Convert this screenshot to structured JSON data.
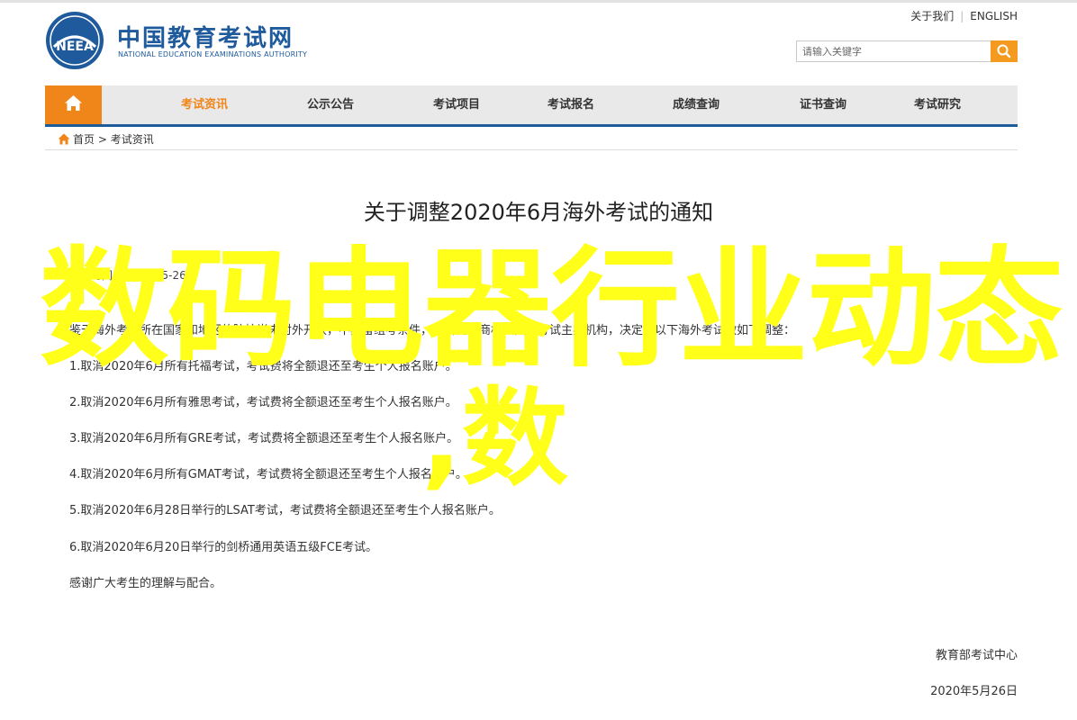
{
  "header": {
    "brand_cn": "中国教育考试网",
    "brand_en": "NATIONAL EDUCATION EXAMINATIONS AUTHORITY",
    "logo_text": "NEEA",
    "util_links": {
      "homepage": "关于我们",
      "english": "ENGLISH"
    },
    "search": {
      "placeholder": "请输入关键字"
    }
  },
  "nav": {
    "items": [
      {
        "label": "考试资讯",
        "active": true
      },
      {
        "label": "公示公告"
      },
      {
        "label": "考试项目"
      },
      {
        "label": "考试报名"
      },
      {
        "label": "成绩查询"
      },
      {
        "label": "证书查询"
      },
      {
        "label": "考试研究"
      }
    ]
  },
  "breadcrumb": {
    "home": "首页",
    "separator": ">",
    "current": "考试资讯"
  },
  "article": {
    "title": "关于调整2020年6月海外考试的通知",
    "meta": "发布时间：2020-05-26",
    "intro": "鉴于海外考点所在国家和地区的院校尚未对外开放，不具备组考条件，经研究并商相关国外考试主办机构，决定对以下海外考试做如下调整：",
    "paragraphs": [
      "1.取消2020年6月所有托福考试，考试费将全额退还至考生个人报名账户。",
      "2.取消2020年6月所有雅思考试，考试费将全额退还至考生个人报名账户。",
      "3.取消2020年6月所有GRE考试，考试费将全额退还至考生个人报名账户。",
      "4.取消2020年6月所有GMAT考试，考试费将全额退还至考生个人报名账户。",
      "5.取消2020年6月28日举行的LSAT考试，考试费将全额退还至考生个人报名账户。",
      "6.取消2020年6月20日举行的剑桥通用英语五级FCE考试。",
      "感谢广大考生的理解与配合。"
    ],
    "signature": "教育部考试中心",
    "date": "2020年5月26日"
  },
  "watermark": {
    "line1": "数码电器行业动态",
    "line2": ",数"
  },
  "colors": {
    "brand_blue": "#1e5a9c",
    "accent_orange": "#f08519",
    "watermark_yellow": "#ffff1a"
  }
}
